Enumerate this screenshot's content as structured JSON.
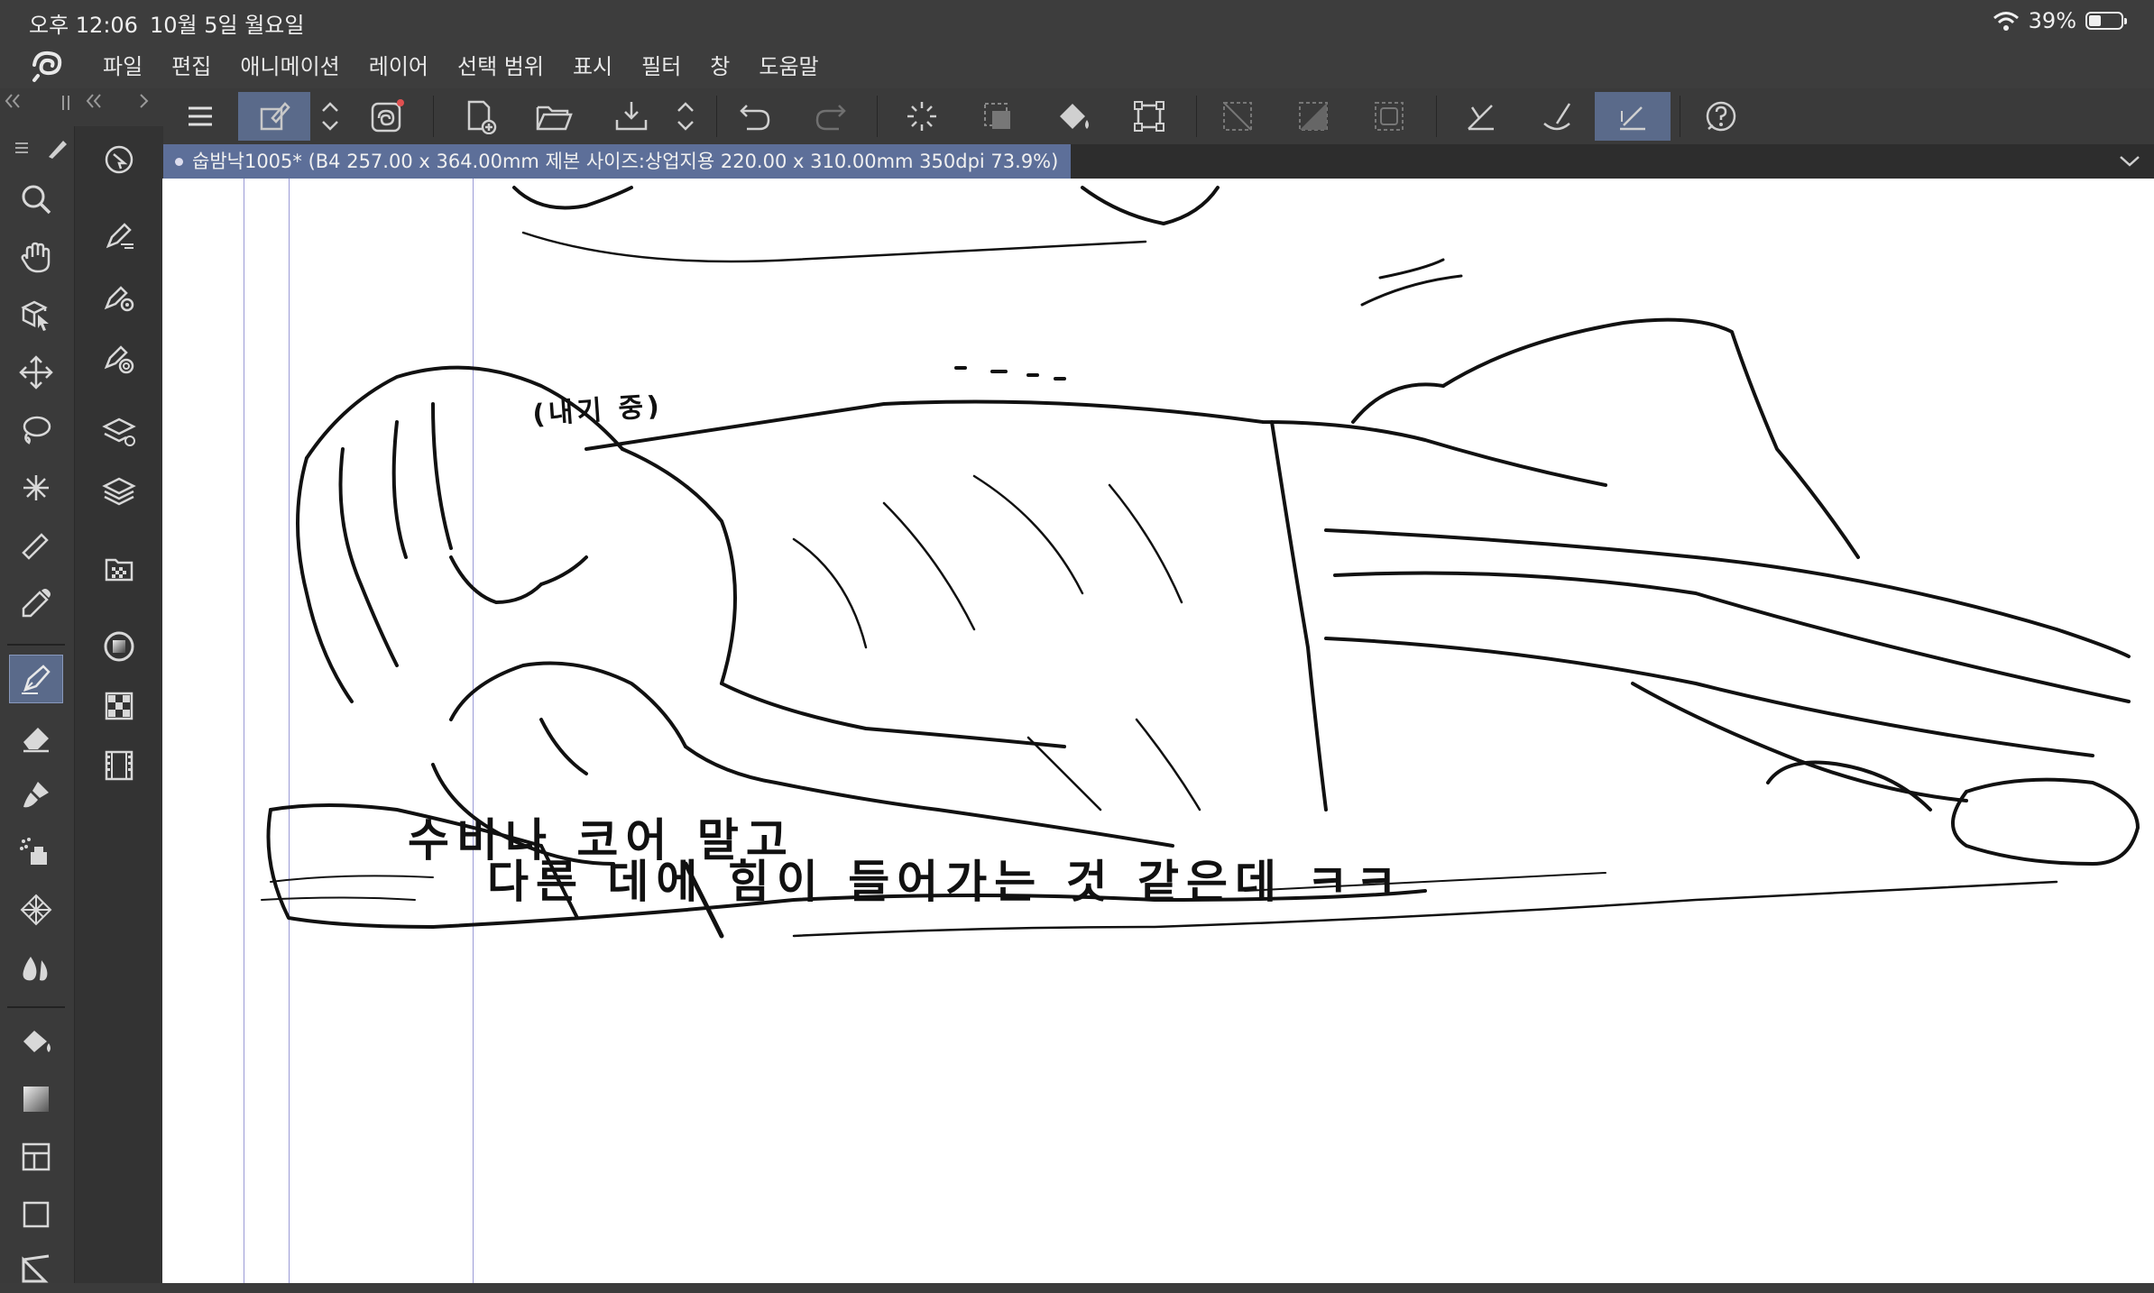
{
  "status_bar": {
    "time": "오후 12:06",
    "date": "10월 5일 월요일",
    "battery_percent": "39%",
    "battery_level": 0.39
  },
  "menu": {
    "items": [
      "파일",
      "편집",
      "애니메이션",
      "레이어",
      "선택 범위",
      "표시",
      "필터",
      "창",
      "도움말"
    ]
  },
  "document": {
    "tab_title": "숩밤낙1005* (B4 257.00 x 364.00mm 제본 사이즈:상업지용 220.00 x 310.00mm 350dpi 73.9%)"
  },
  "canvas": {
    "note_small": "(내기 중)",
    "note_line1": "수비나 코어 말고",
    "note_line2": "다른 데에 힘이 들어가는 것 같은데 ㅋㅋ"
  },
  "icons": {
    "tools": [
      "search-icon",
      "hand-icon",
      "object-select-icon",
      "move-icon",
      "lasso-icon",
      "magic-wand-icon",
      "ruler-icon",
      "eyedropper-icon",
      "pen-icon",
      "eraser-icon",
      "brush-icon",
      "airbrush-icon",
      "pattern-icon",
      "blend-icon",
      "fill-icon",
      "gradient-icon",
      "frame-icon",
      "rectangle-icon",
      "ruler-triangle-icon"
    ],
    "accent": "#5d6f99"
  }
}
